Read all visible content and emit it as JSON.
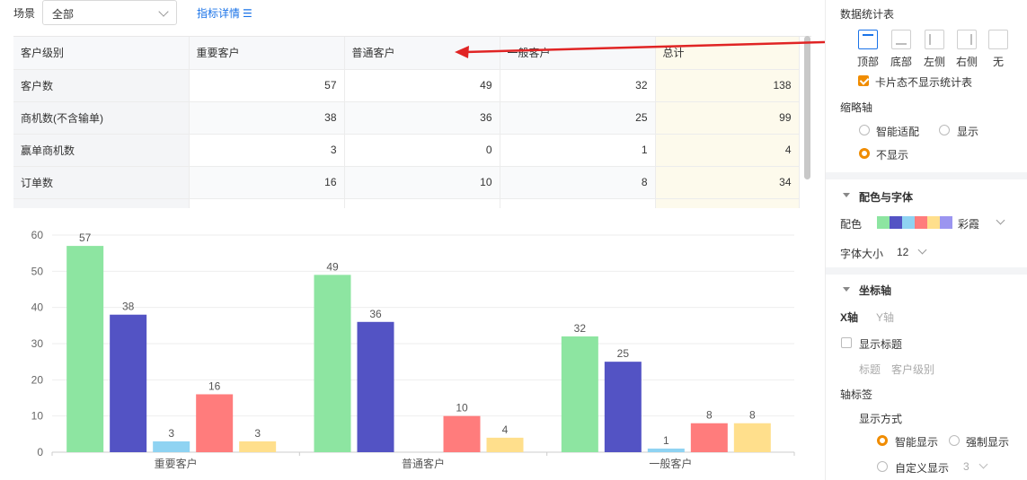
{
  "filter": {
    "scene_label": "场景",
    "scene_value": "全部",
    "metric_link": "指标详情"
  },
  "table": {
    "headers": [
      "客户级别",
      "重要客户",
      "普通客户",
      "一般客户",
      "总计"
    ],
    "rows": [
      {
        "label": "客户数",
        "values": [
          "57",
          "49",
          "32",
          "138"
        ]
      },
      {
        "label": "商机数(不含输单)",
        "values": [
          "38",
          "36",
          "25",
          "99"
        ]
      },
      {
        "label": "赢单商机数",
        "values": [
          "3",
          "0",
          "1",
          "4"
        ]
      },
      {
        "label": "订单数",
        "values": [
          "16",
          "10",
          "8",
          "34"
        ]
      }
    ]
  },
  "chart_data": {
    "type": "bar",
    "categories": [
      "重要客户",
      "普通客户",
      "一般客户"
    ],
    "series": [
      {
        "values": [
          57,
          49,
          32
        ],
        "color": "#8de5a1"
      },
      {
        "values": [
          38,
          36,
          25
        ],
        "color": "#5353c4"
      },
      {
        "values": [
          3,
          0,
          1
        ],
        "color": "#8fd3f2"
      },
      {
        "values": [
          16,
          10,
          8
        ],
        "color": "#ff7c7c"
      },
      {
        "values": [
          3,
          4,
          8
        ],
        "color": "#ffdf8c"
      }
    ],
    "yticks": [
      0,
      10,
      20,
      30,
      40,
      50,
      60
    ],
    "ylim": [
      0,
      60
    ],
    "grid": true,
    "data_labels": true
  },
  "panel": {
    "stats_table_title": "数据统计表",
    "positions": [
      "顶部",
      "底部",
      "左侧",
      "右侧",
      "无"
    ],
    "active_position": "顶部",
    "card_hide_label": "卡片态不显示统计表",
    "thumb_axis_title": "缩略轴",
    "thumb_options": [
      "智能适配",
      "显示",
      "不显示"
    ],
    "thumb_selected": "不显示",
    "color_font_title": "配色与字体",
    "color_label": "配色",
    "palette_name": "彩霞",
    "palette": [
      "#8de5a1",
      "#5353c4",
      "#8fd3f2",
      "#ff7c7c",
      "#ffdf8c",
      "#9b95f0"
    ],
    "font_size_label": "字体大小",
    "font_size_value": "12",
    "axis_title": "坐标轴",
    "axis_tabs": [
      "X轴",
      "Y轴"
    ],
    "show_title_label": "显示标题",
    "title_label": "标题",
    "title_value": "客户级别",
    "axis_tick_title": "轴标签",
    "display_mode_label": "显示方式",
    "display_options": [
      "智能显示",
      "强制显示",
      "自定义显示"
    ],
    "display_selected": "智能显示",
    "custom_value": "3"
  }
}
